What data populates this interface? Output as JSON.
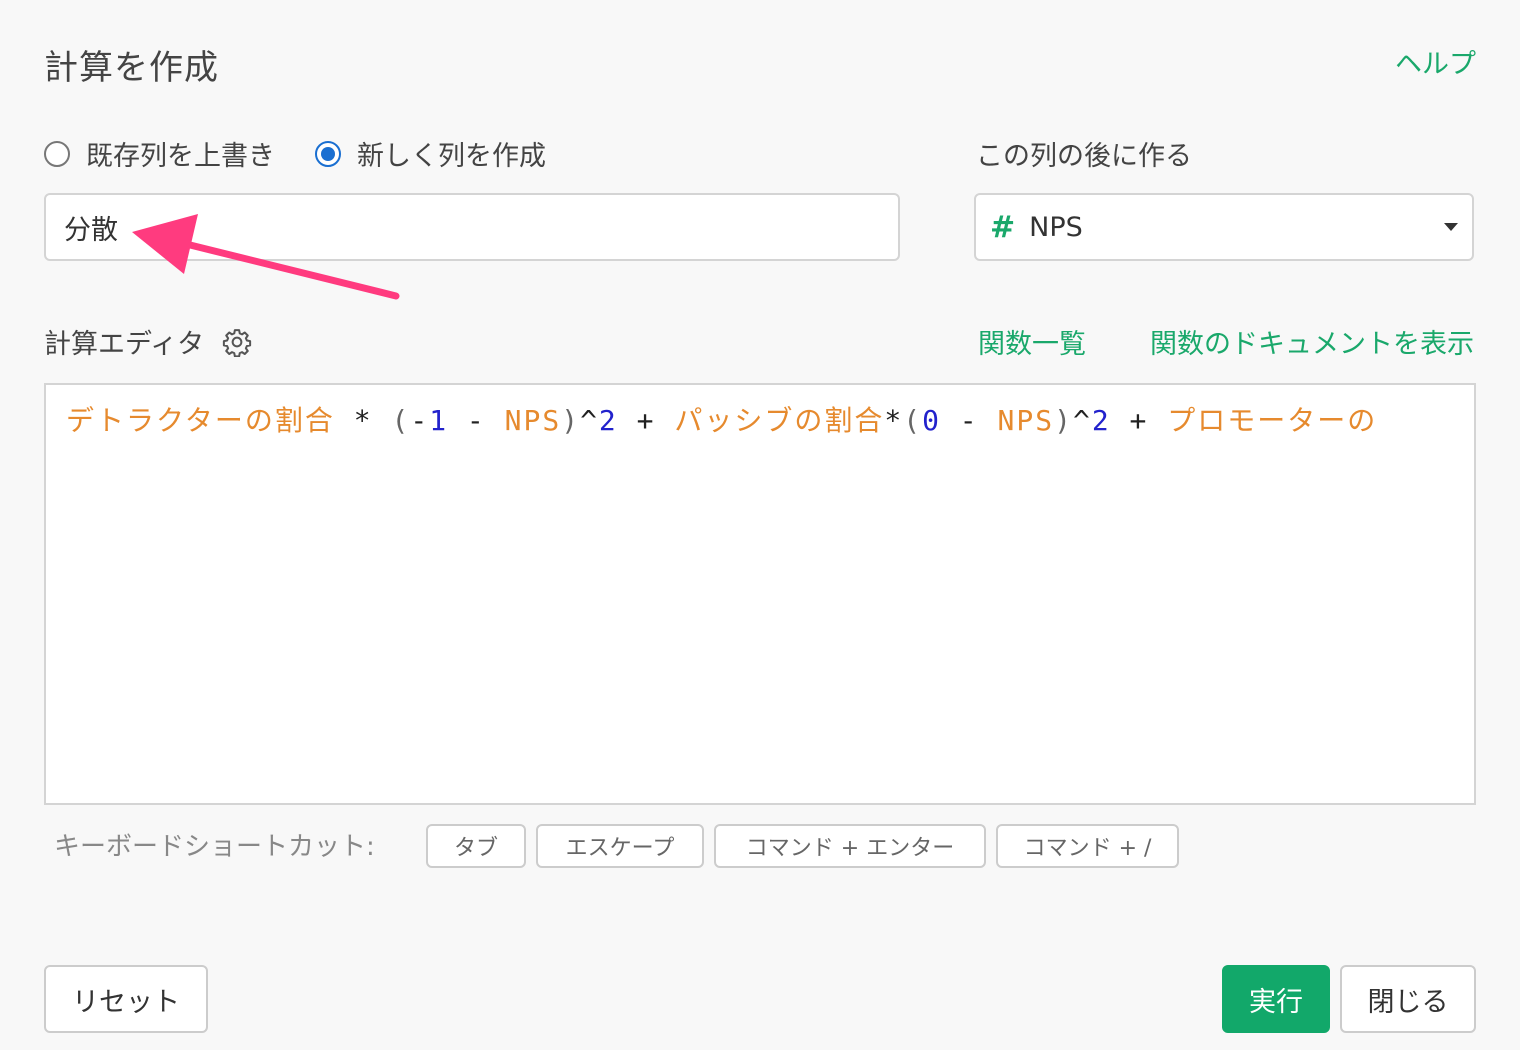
{
  "dialog": {
    "title": "計算を作成",
    "help_label": "ヘルプ"
  },
  "mode": {
    "options": [
      {
        "label": "既存列を上書き",
        "checked": false
      },
      {
        "label": "新しく列を作成",
        "checked": true
      }
    ]
  },
  "new_column": {
    "value": "分散"
  },
  "position": {
    "label": "この列の後に作る",
    "type_icon": "#",
    "selected": "NPS"
  },
  "editor": {
    "label": "計算エディタ",
    "settings_icon": "gear-icon",
    "function_list_label": "関数一覧",
    "function_docs_label": "関数のドキュメントを表示",
    "tokens": [
      {
        "t": "id",
        "v": "デトラクターの割合"
      },
      {
        "t": "op",
        "v": " * "
      },
      {
        "t": "paren",
        "v": "("
      },
      {
        "t": "op",
        "v": "-"
      },
      {
        "t": "num",
        "v": "1"
      },
      {
        "t": "op",
        "v": " - "
      },
      {
        "t": "id",
        "v": "NPS"
      },
      {
        "t": "paren",
        "v": ")"
      },
      {
        "t": "op",
        "v": "^"
      },
      {
        "t": "num",
        "v": "2"
      },
      {
        "t": "op",
        "v": " + "
      },
      {
        "t": "id",
        "v": "パッシブの割合"
      },
      {
        "t": "op",
        "v": "*"
      },
      {
        "t": "paren",
        "v": "("
      },
      {
        "t": "num",
        "v": "0"
      },
      {
        "t": "op",
        "v": " - "
      },
      {
        "t": "id",
        "v": "NPS"
      },
      {
        "t": "paren",
        "v": ")"
      },
      {
        "t": "op",
        "v": "^"
      },
      {
        "t": "num",
        "v": "2"
      },
      {
        "t": "op",
        "v": " + "
      },
      {
        "t": "id",
        "v": "プロモーターの"
      }
    ]
  },
  "shortcuts": {
    "label": "キーボードショートカット:",
    "keys": [
      "タブ",
      "エスケープ",
      "コマンド + エンター",
      "コマンド + /"
    ]
  },
  "footer": {
    "reset_label": "リセット",
    "run_label": "実行",
    "close_label": "閉じる"
  },
  "colors": {
    "accent_green": "#1aa86b",
    "radio_blue": "#1a6fd1",
    "annotation_arrow": "#ff3b7f",
    "token_identifier": "#e68a2e",
    "token_number": "#2222cc"
  }
}
